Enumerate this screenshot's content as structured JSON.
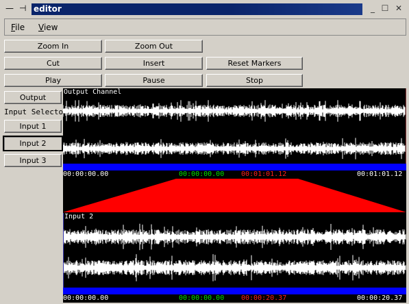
{
  "window": {
    "title": "editor",
    "buttons": {
      "minimize": "—",
      "pin": "⊣",
      "min2": "_",
      "max": "☐",
      "close": "✕"
    }
  },
  "menu": {
    "file": "File",
    "view": "View"
  },
  "toolbar": {
    "zoom_in": "Zoom In",
    "zoom_out": "Zoom Out",
    "cut": "Cut",
    "insert": "Insert",
    "reset_markers": "Reset Markers",
    "play": "Play",
    "pause": "Pause",
    "stop": "Stop"
  },
  "sidebar": {
    "output": "Output",
    "input_selector": "Input Selector",
    "input1": "Input 1",
    "input2": "Input 2",
    "input3": "Input 3",
    "selected": "Input 2"
  },
  "output_panel": {
    "label": "Output Channel",
    "time_start": "00:00:00.00",
    "marker_start": "00:00:00.00",
    "marker_end": "00:01:01.12",
    "time_end": "00:01:01.12"
  },
  "input_panel": {
    "label": "Input 2",
    "time_start": "00:00:00.00",
    "marker_start": "00:00:00.00",
    "marker_end": "00:00:20.37",
    "time_end": "00:00:20.37"
  },
  "colors": {
    "waveform": "#ffffff",
    "background": "#000000",
    "timebar": "#0000ff",
    "envelope": "#ff0000",
    "marker_start": "#00e000",
    "marker_end": "#ff2020"
  }
}
